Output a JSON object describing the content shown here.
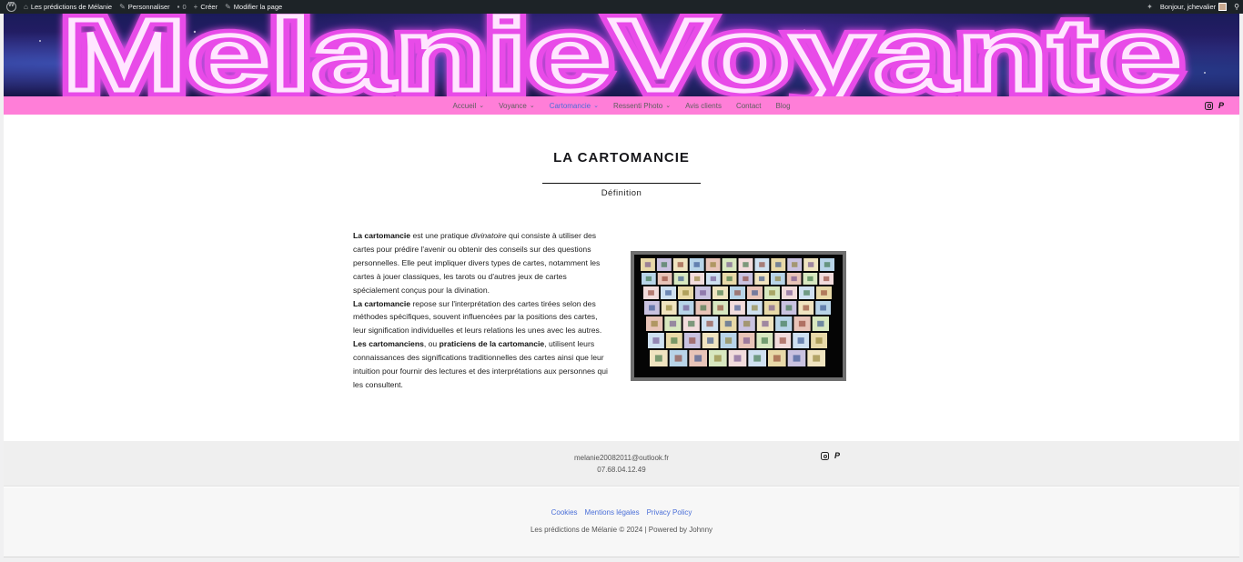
{
  "admin_bar": {
    "site_name": "Les prédictions de Mélanie",
    "customize": "Personnaliser",
    "comments_count": "0",
    "new": "Créer",
    "edit_page": "Modifier la page",
    "greeting": "Bonjour, jchevalier"
  },
  "banner": {
    "text": "MelanieVoyante"
  },
  "nav": {
    "items": [
      {
        "label": "Accueil",
        "dropdown": true
      },
      {
        "label": "Voyance",
        "dropdown": true
      },
      {
        "label": "Cartomancie",
        "dropdown": true,
        "active": true
      },
      {
        "label": "Ressenti Photo",
        "dropdown": true
      },
      {
        "label": "Avis clients",
        "dropdown": false
      },
      {
        "label": "Contact",
        "dropdown": false
      },
      {
        "label": "Blog",
        "dropdown": false
      }
    ],
    "social": [
      "instagram-icon",
      "paypal-icon"
    ]
  },
  "content": {
    "title": "LA CARTOMANCIE",
    "subtitle": "Définition",
    "p1_bold": "La cartomancie",
    "p1_a": " est une pratique ",
    "p1_italic": "divinatoire",
    "p1_b": " qui consiste à utiliser des cartes pour prédire l'avenir ou obtenir des conseils sur des questions personnelles. Elle peut impliquer divers types de cartes, notamment les cartes à jouer classiques, les tarots ou d'autres jeux de cartes spécialement conçus pour la divination.",
    "p2_bold": "La cartomancie",
    "p2_rest": " repose sur l'interprétation des cartes tirées selon des méthodes spécifiques, souvent influencées par la positions des cartes, leur signification individuelles et leurs relations les unes avec les autres.",
    "p3_bold1": "Les cartomanciens",
    "p3_mid": ", ou ",
    "p3_bold2": "praticiens de la cartomancie",
    "p3_rest": ", utilisent leurs connaissances des significations traditionnelles des cartes ainsi que leur intuition pour fournir des lectures et des interprétations aux personnes qui les consultent."
  },
  "footer": {
    "email": "melanie20082011@outlook.fr",
    "phone": "07.68.04.12.49",
    "links": [
      "Cookies",
      "Mentions légales",
      "Privacy Policy"
    ],
    "copyright": "Les prédictions de Mélanie © 2024 | Powered by Johnny"
  },
  "colors": {
    "nav_bg": "#ff7ed8",
    "nav_active": "#4a6fd8",
    "banner_neon": "#e84be8",
    "admin_bar": "#1d2327"
  }
}
